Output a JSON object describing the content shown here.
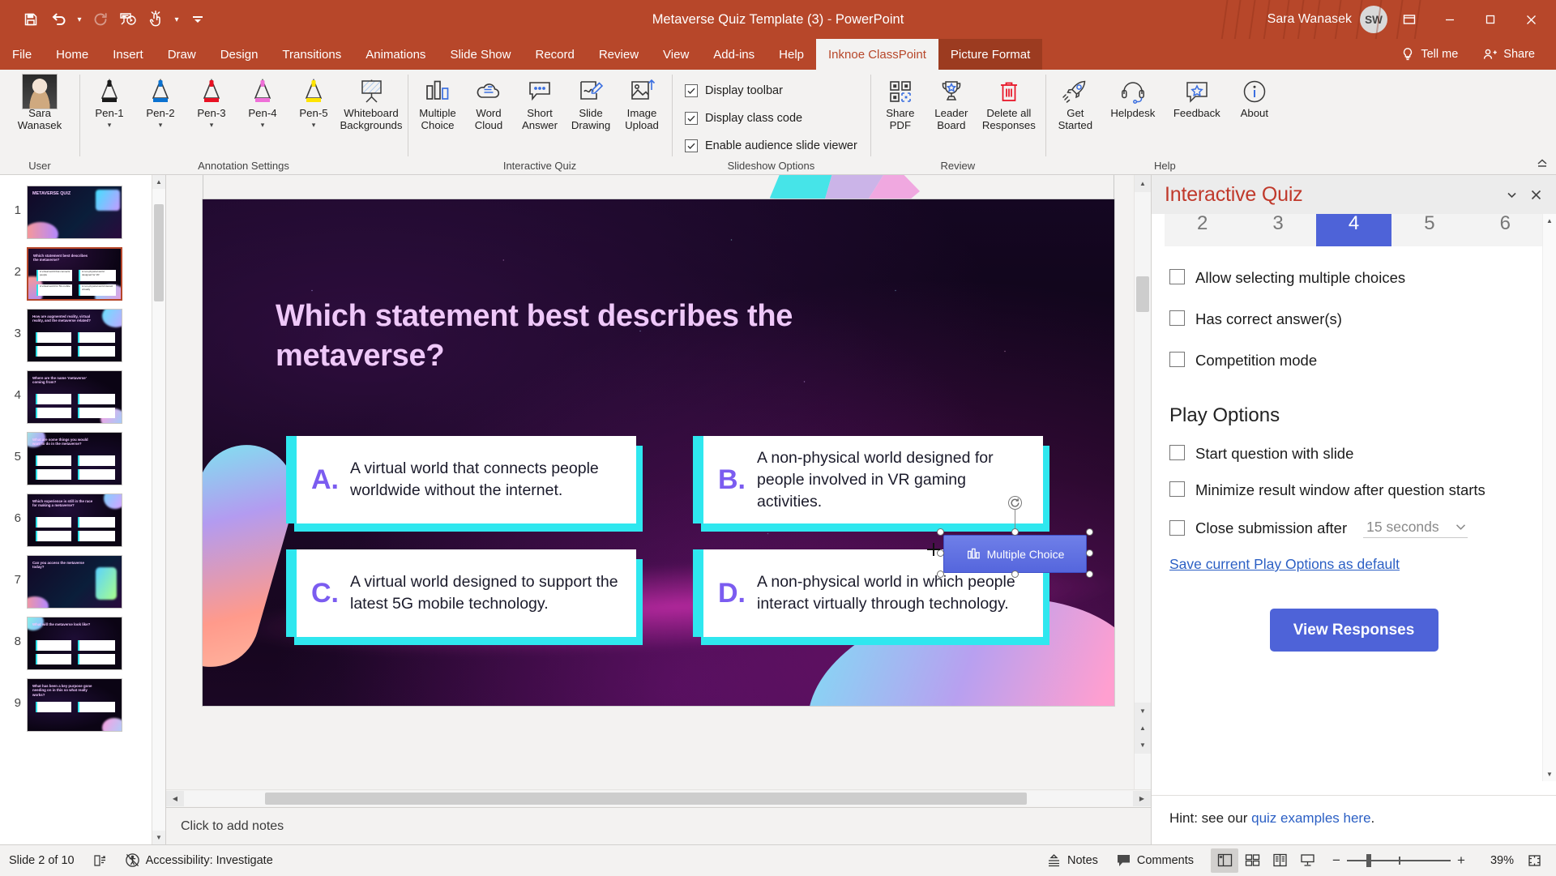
{
  "titlebar": {
    "document_title": "Metaverse Quiz Template (3)",
    "separator": "-",
    "app_name": "PowerPoint",
    "user_name": "Sara Wanasek",
    "user_initials": "SW",
    "qat": [
      {
        "name": "save",
        "icon": "save-icon"
      },
      {
        "name": "undo",
        "icon": "undo-icon"
      },
      {
        "name": "undo-dropdown",
        "icon": "chevron-down-icon"
      },
      {
        "name": "redo",
        "icon": "redo-icon"
      },
      {
        "name": "start-presentation",
        "icon": "present-icon"
      },
      {
        "name": "touch-mode",
        "icon": "touch-icon"
      },
      {
        "name": "touch-dropdown",
        "icon": "chevron-down-icon"
      },
      {
        "name": "customize-qat",
        "icon": "overflow-icon"
      }
    ],
    "window_buttons": [
      {
        "name": "ribbon-display-options",
        "icon": "restore-down-icon"
      },
      {
        "name": "minimize",
        "icon": "minimize-icon"
      },
      {
        "name": "restore",
        "icon": "restore-icon"
      },
      {
        "name": "close",
        "icon": "close-icon"
      }
    ]
  },
  "tabs": [
    {
      "label": "File",
      "state": "normal"
    },
    {
      "label": "Home",
      "state": "normal"
    },
    {
      "label": "Insert",
      "state": "normal"
    },
    {
      "label": "Draw",
      "state": "normal"
    },
    {
      "label": "Design",
      "state": "normal"
    },
    {
      "label": "Transitions",
      "state": "normal"
    },
    {
      "label": "Animations",
      "state": "normal"
    },
    {
      "label": "Slide Show",
      "state": "normal"
    },
    {
      "label": "Record",
      "state": "normal"
    },
    {
      "label": "Review",
      "state": "normal"
    },
    {
      "label": "View",
      "state": "normal"
    },
    {
      "label": "Add-ins",
      "state": "normal"
    },
    {
      "label": "Help",
      "state": "normal"
    },
    {
      "label": "Inknoe ClassPoint",
      "state": "active"
    },
    {
      "label": "Picture Format",
      "state": "contextual"
    }
  ],
  "tab_right": {
    "tell_me": "Tell me",
    "share": "Share"
  },
  "ribbon": {
    "groups": [
      {
        "label": "User",
        "items": [
          {
            "label_line1": "Sara",
            "label_line2": "Wanasek",
            "icon": "user-avatar",
            "caret": false
          }
        ]
      },
      {
        "label": "Annotation Settings",
        "items": [
          {
            "label_line1": "Pen-1",
            "label_line2": "",
            "icon": "pen-black-icon",
            "caret": true,
            "color": "#1a1a1a"
          },
          {
            "label_line1": "Pen-2",
            "label_line2": "",
            "icon": "pen-blue-icon",
            "caret": true,
            "color": "#0b72d0"
          },
          {
            "label_line1": "Pen-3",
            "label_line2": "",
            "icon": "pen-red-icon",
            "caret": true,
            "color": "#e81123"
          },
          {
            "label_line1": "Pen-4",
            "label_line2": "",
            "icon": "pen-pink-icon",
            "caret": true,
            "color": "#ef6fd8"
          },
          {
            "label_line1": "Pen-5",
            "label_line2": "",
            "icon": "pen-yellow-icon",
            "caret": true,
            "color": "#ffe400"
          },
          {
            "label_line1": "Whiteboard",
            "label_line2": "Backgrounds",
            "icon": "whiteboard-icon",
            "caret": false
          }
        ]
      },
      {
        "label": "Interactive Quiz",
        "items": [
          {
            "label_line1": "Multiple",
            "label_line2": "Choice",
            "icon": "multiple-choice-icon",
            "caret": false
          },
          {
            "label_line1": "Word",
            "label_line2": "Cloud",
            "icon": "word-cloud-icon",
            "caret": false
          },
          {
            "label_line1": "Short",
            "label_line2": "Answer",
            "icon": "short-answer-icon",
            "caret": false
          },
          {
            "label_line1": "Slide",
            "label_line2": "Drawing",
            "icon": "slide-drawing-icon",
            "caret": false
          },
          {
            "label_line1": "Image",
            "label_line2": "Upload",
            "icon": "image-upload-icon",
            "caret": false
          }
        ]
      },
      {
        "label": "Slideshow Options",
        "checkboxes": [
          {
            "label": "Display toolbar",
            "checked": true
          },
          {
            "label": "Display class code",
            "checked": true
          },
          {
            "label": "Enable audience slide viewer",
            "checked": true
          }
        ]
      },
      {
        "label": "Review",
        "items": [
          {
            "label_line1": "Share",
            "label_line2": "PDF",
            "icon": "qr-code-icon",
            "caret": false
          },
          {
            "label_line1": "Leader",
            "label_line2": "Board",
            "icon": "trophy-icon",
            "caret": false
          },
          {
            "label_line1": "Delete all",
            "label_line2": "Responses",
            "icon": "trash-icon",
            "caret": false
          }
        ]
      },
      {
        "label": "Help",
        "items": [
          {
            "label_line1": "Get",
            "label_line2": "Started",
            "icon": "rocket-icon",
            "caret": false
          },
          {
            "label_line1": "Helpdesk",
            "label_line2": "",
            "icon": "headset-icon",
            "caret": false
          },
          {
            "label_line1": "Feedback",
            "label_line2": "",
            "icon": "feedback-star-icon",
            "caret": false
          },
          {
            "label_line1": "About",
            "label_line2": "",
            "icon": "info-icon",
            "caret": false
          }
        ]
      }
    ]
  },
  "thumbnails": [
    {
      "number": "1",
      "selected": false,
      "title": "METAVERSE QUIZ",
      "kind": "cover"
    },
    {
      "number": "2",
      "selected": true,
      "title": "Which statement best describes the metaverse?",
      "kind": "quiz4"
    },
    {
      "number": "3",
      "selected": false,
      "title": "How are augmented reality, virtual reality, and the metaverse related?",
      "kind": "quiz4"
    },
    {
      "number": "4",
      "selected": false,
      "title": "Where are the name 'metaverse' coming from?",
      "kind": "quiz4"
    },
    {
      "number": "5",
      "selected": false,
      "title": "What are some things you would want to do in the metaverse?",
      "kind": "quiz4"
    },
    {
      "number": "6",
      "selected": false,
      "title": "Which experience is still in the race for making a metaverse?",
      "kind": "quiz4"
    },
    {
      "number": "7",
      "selected": false,
      "title": "Can you access the metaverse today?",
      "kind": "cover2"
    },
    {
      "number": "8",
      "selected": false,
      "title": "What will the metaverse look like?",
      "kind": "quiz4"
    },
    {
      "number": "9",
      "selected": false,
      "title": "What has been a key purpose gone needing on in this so what really works?",
      "kind": "quiz4"
    }
  ],
  "slide": {
    "title": "Which statement best describes the metaverse?",
    "answers": [
      {
        "letter": "A.",
        "text": "A virtual world that connects people worldwide without the internet."
      },
      {
        "letter": "B.",
        "text": "A non-physical world designed for people involved in VR gaming activities."
      },
      {
        "letter": "C.",
        "text": "A virtual world designed to support the latest 5G mobile technology."
      },
      {
        "letter": "D.",
        "text": "A non-physical world in which people interact virtually through technology."
      }
    ],
    "selected_object": {
      "label": "Multiple Choice",
      "icon": "multiple-choice-icon"
    }
  },
  "notes": {
    "placeholder": "Click to add notes"
  },
  "pane": {
    "title": "Interactive Quiz",
    "header_buttons": [
      {
        "name": "pane-options",
        "icon": "chevron-down-icon"
      },
      {
        "name": "pane-close",
        "icon": "close-icon"
      }
    ],
    "choice_numbers": [
      "2",
      "3",
      "4",
      "5",
      "6"
    ],
    "choice_selected": "4",
    "options": [
      {
        "label": "Allow selecting multiple choices",
        "checked": false
      },
      {
        "label": "Has correct answer(s)",
        "checked": false
      },
      {
        "label": "Competition mode",
        "checked": false
      }
    ],
    "play_options_heading": "Play Options",
    "play_options": [
      {
        "label": "Start question with slide",
        "checked": false
      },
      {
        "label": "Minimize result window after question starts",
        "checked": false
      },
      {
        "label": "Close submission after",
        "checked": false,
        "select_value": "15 seconds"
      }
    ],
    "save_default_link": "Save current Play Options as default",
    "view_responses_button": "View Responses",
    "hint_prefix": "Hint: see our ",
    "hint_link": "quiz examples here",
    "hint_suffix": "."
  },
  "status": {
    "slide_indicator": "Slide 2 of 10",
    "language_icon": "language-icon",
    "accessibility": "Accessibility: Investigate",
    "notes_label": "Notes",
    "comments_label": "Comments",
    "views": [
      {
        "name": "normal-view",
        "icon": "normal-view-icon",
        "active": true
      },
      {
        "name": "slide-sorter-view",
        "icon": "slide-sorter-icon",
        "active": false
      },
      {
        "name": "reading-view",
        "icon": "reading-view-icon",
        "active": false
      },
      {
        "name": "slide-show-view",
        "icon": "slide-show-icon",
        "active": false
      }
    ],
    "zoom_level": "39%",
    "zoom_minus": "−",
    "zoom_plus": "+",
    "fit_slide_icon": "fit-to-window-icon"
  },
  "colors": {
    "accent": "#b7472a",
    "pane_title": "#c0392b",
    "primary_button": "#4e63d8",
    "link": "#2b5fc4",
    "slide_title": "#efc8f9",
    "answer_accent": "#2fe7ef",
    "letter": "#7b5cf0"
  }
}
